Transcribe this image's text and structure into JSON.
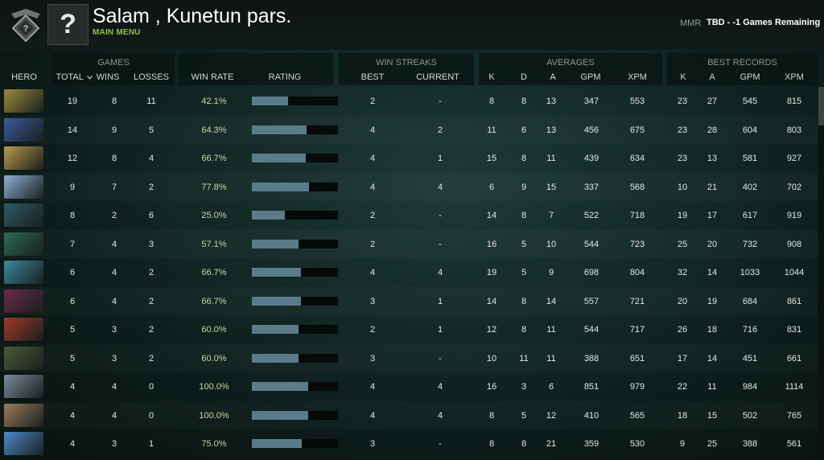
{
  "header": {
    "player_name": "Salam , Kunetun pars.",
    "main_menu": "MAIN MENU",
    "avatar_glyph": "?",
    "mmr_label": "MMR",
    "mmr_value": "TBD - -1 Games Remaining"
  },
  "groups": {
    "games": "GAMES",
    "win_streaks": "WIN STREAKS",
    "averages": "AVERAGES",
    "best_records": "BEST RECORDS"
  },
  "columns": {
    "hero": "HERO",
    "total": "TOTAL",
    "wins": "WINS",
    "losses": "LOSSES",
    "win_rate": "WIN RATE",
    "rating": "RATING",
    "best": "BEST",
    "current": "CURRENT",
    "avg_k": "K",
    "avg_d": "D",
    "avg_a": "A",
    "avg_gpm": "GPM",
    "avg_xpm": "XPM",
    "best_k": "K",
    "best_a": "A",
    "best_gpm": "GPM",
    "best_xpm": "XPM"
  },
  "sort_icon": "chevron-down-icon",
  "rows": [
    {
      "total": "19",
      "wins": "8",
      "losses": "11",
      "win_rate": "42.1%",
      "rating": 0.42,
      "best": "2",
      "current": "-",
      "k": "8",
      "d": "8",
      "a": "13",
      "gpm": "347",
      "xpm": "553",
      "bk": "23",
      "ba": "27",
      "bgpm": "545",
      "bxpm": "815",
      "color": "#9a8a3c"
    },
    {
      "total": "14",
      "wins": "9",
      "losses": "5",
      "win_rate": "64.3%",
      "rating": 0.64,
      "best": "4",
      "current": "2",
      "k": "11",
      "d": "6",
      "a": "13",
      "gpm": "456",
      "xpm": "675",
      "bk": "23",
      "ba": "28",
      "bgpm": "604",
      "bxpm": "803",
      "color": "#3d5a9e"
    },
    {
      "total": "12",
      "wins": "8",
      "losses": "4",
      "win_rate": "66.7%",
      "rating": 0.63,
      "best": "4",
      "current": "1",
      "k": "15",
      "d": "8",
      "a": "11",
      "gpm": "439",
      "xpm": "634",
      "bk": "23",
      "ba": "13",
      "bgpm": "581",
      "bxpm": "927",
      "color": "#b89a4c"
    },
    {
      "total": "9",
      "wins": "7",
      "losses": "2",
      "win_rate": "77.8%",
      "rating": 0.66,
      "best": "4",
      "current": "4",
      "k": "6",
      "d": "9",
      "a": "15",
      "gpm": "337",
      "xpm": "568",
      "bk": "10",
      "ba": "21",
      "bgpm": "402",
      "bxpm": "702",
      "color": "#8fb0d8"
    },
    {
      "total": "8",
      "wins": "2",
      "losses": "6",
      "win_rate": "25.0%",
      "rating": 0.38,
      "best": "2",
      "current": "-",
      "k": "14",
      "d": "8",
      "a": "7",
      "gpm": "522",
      "xpm": "718",
      "bk": "19",
      "ba": "17",
      "bgpm": "617",
      "bxpm": "919",
      "color": "#2e5a64"
    },
    {
      "total": "7",
      "wins": "4",
      "losses": "3",
      "win_rate": "57.1%",
      "rating": 0.54,
      "best": "2",
      "current": "-",
      "k": "16",
      "d": "5",
      "a": "10",
      "gpm": "544",
      "xpm": "723",
      "bk": "25",
      "ba": "20",
      "bgpm": "732",
      "bxpm": "908",
      "color": "#2f6a58"
    },
    {
      "total": "6",
      "wins": "4",
      "losses": "2",
      "win_rate": "66.7%",
      "rating": 0.57,
      "best": "4",
      "current": "4",
      "k": "19",
      "d": "5",
      "a": "9",
      "gpm": "698",
      "xpm": "804",
      "bk": "32",
      "ba": "14",
      "bgpm": "1033",
      "bxpm": "1044",
      "color": "#3a8aa0"
    },
    {
      "total": "6",
      "wins": "4",
      "losses": "2",
      "win_rate": "66.7%",
      "rating": 0.57,
      "best": "3",
      "current": "1",
      "k": "14",
      "d": "8",
      "a": "14",
      "gpm": "557",
      "xpm": "721",
      "bk": "20",
      "ba": "19",
      "bgpm": "684",
      "bxpm": "861",
      "color": "#6a2a4a"
    },
    {
      "total": "5",
      "wins": "3",
      "losses": "2",
      "win_rate": "60.0%",
      "rating": 0.54,
      "best": "2",
      "current": "1",
      "k": "12",
      "d": "8",
      "a": "11",
      "gpm": "544",
      "xpm": "717",
      "bk": "26",
      "ba": "18",
      "bgpm": "716",
      "bxpm": "831",
      "color": "#a03a2a"
    },
    {
      "total": "5",
      "wins": "3",
      "losses": "2",
      "win_rate": "60.0%",
      "rating": 0.54,
      "best": "3",
      "current": "-",
      "k": "10",
      "d": "11",
      "a": "11",
      "gpm": "388",
      "xpm": "651",
      "bk": "17",
      "ba": "14",
      "bgpm": "451",
      "bxpm": "661",
      "color": "#4a5a3a"
    },
    {
      "total": "4",
      "wins": "4",
      "losses": "0",
      "win_rate": "100.0%",
      "rating": 0.65,
      "best": "4",
      "current": "4",
      "k": "16",
      "d": "3",
      "a": "6",
      "gpm": "851",
      "xpm": "979",
      "bk": "22",
      "ba": "11",
      "bgpm": "984",
      "bxpm": "1114",
      "color": "#7a8a9a"
    },
    {
      "total": "4",
      "wins": "4",
      "losses": "0",
      "win_rate": "100.0%",
      "rating": 0.65,
      "best": "4",
      "current": "4",
      "k": "8",
      "d": "5",
      "a": "12",
      "gpm": "410",
      "xpm": "565",
      "bk": "18",
      "ba": "15",
      "bgpm": "502",
      "bxpm": "765",
      "color": "#9a7a5a"
    },
    {
      "total": "4",
      "wins": "3",
      "losses": "1",
      "win_rate": "75.0%",
      "rating": 0.58,
      "best": "3",
      "current": "-",
      "k": "8",
      "d": "8",
      "a": "21",
      "gpm": "359",
      "xpm": "530",
      "bk": "9",
      "ba": "25",
      "bgpm": "388",
      "bxpm": "561",
      "color": "#4a8ac8"
    }
  ]
}
